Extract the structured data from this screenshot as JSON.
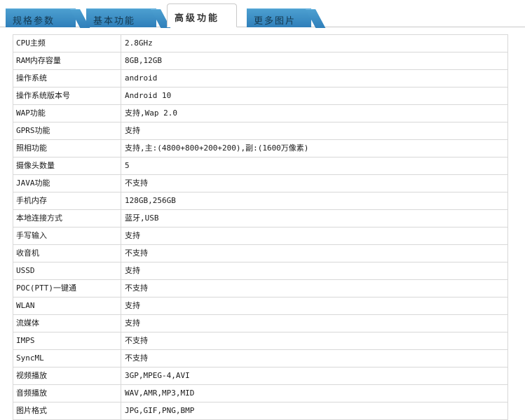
{
  "tabs": [
    {
      "label": "规格参数",
      "active": false
    },
    {
      "label": "基本功能",
      "active": false
    },
    {
      "label": "高级功能",
      "active": true
    },
    {
      "label": "更多图片",
      "active": false
    }
  ],
  "colors": {
    "tab_active_bg": "#ffffff",
    "tab_inactive_bg": "#3d8fc6",
    "table_border": "#d8d8d8"
  },
  "specs": [
    {
      "name": "CPU主频",
      "value": "2.8GHz"
    },
    {
      "name": "RAM内存容量",
      "value": "8GB,12GB"
    },
    {
      "name": "操作系统",
      "value": "android"
    },
    {
      "name": "操作系统版本号",
      "value": "Android 10"
    },
    {
      "name": "WAP功能",
      "value": "支持,Wap 2.0"
    },
    {
      "name": "GPRS功能",
      "value": "支持"
    },
    {
      "name": "照相功能",
      "value": "支持,主:(4800+800+200+200),副:(1600万像素)"
    },
    {
      "name": "摄像头数量",
      "value": "5"
    },
    {
      "name": "JAVA功能",
      "value": "不支持"
    },
    {
      "name": "手机内存",
      "value": "128GB,256GB"
    },
    {
      "name": "本地连接方式",
      "value": "蓝牙,USB"
    },
    {
      "name": "手写输入",
      "value": "支持"
    },
    {
      "name": "收音机",
      "value": "不支持"
    },
    {
      "name": "USSD",
      "value": "支持"
    },
    {
      "name": "POC(PTT)一键通",
      "value": "不支持"
    },
    {
      "name": "WLAN",
      "value": "支持"
    },
    {
      "name": "流媒体",
      "value": "支持"
    },
    {
      "name": "IMPS",
      "value": "不支持"
    },
    {
      "name": "SyncML",
      "value": "不支持"
    },
    {
      "name": "视频播放",
      "value": "3GP,MPEG-4,AVI"
    },
    {
      "name": "音频播放",
      "value": "WAV,AMR,MP3,MID"
    },
    {
      "name": "图片格式",
      "value": "JPG,GIF,PNG,BMP"
    }
  ]
}
